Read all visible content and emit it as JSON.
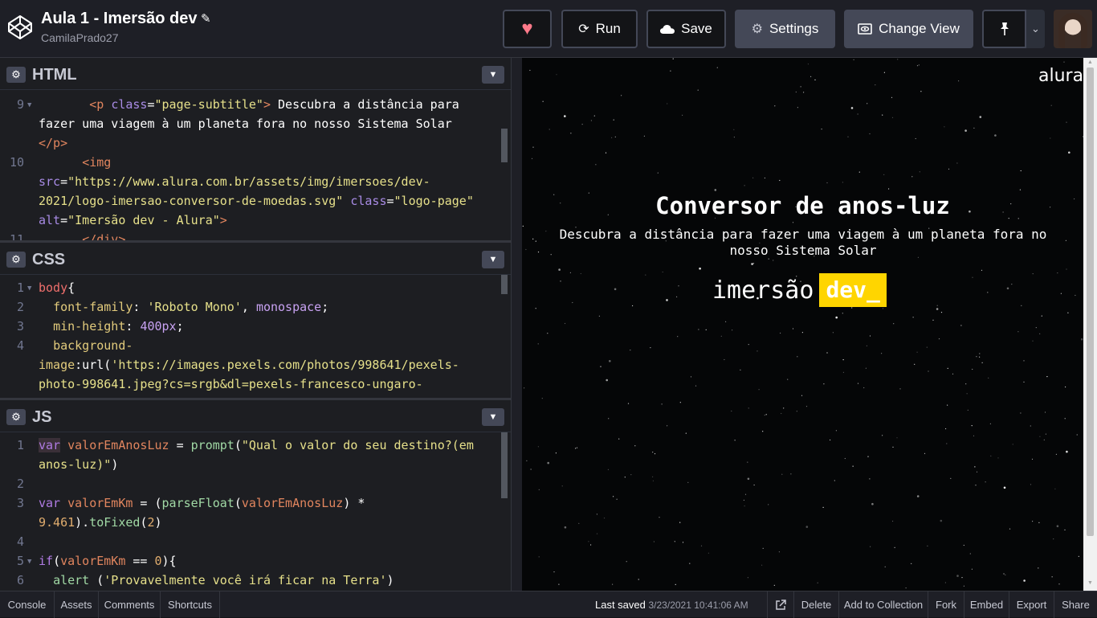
{
  "header": {
    "title": "Aula 1 - Imersão dev",
    "username": "CamilaPrado27",
    "buttons": {
      "run": "Run",
      "save": "Save",
      "settings": "Settings",
      "change_view": "Change View"
    },
    "icons": [
      "codepen-logo-icon",
      "pencil-icon",
      "heart-icon",
      "run-icon",
      "cloud-icon",
      "gear-icon",
      "change-view-icon",
      "pin-icon",
      "chevron-down-icon"
    ],
    "heart_color": "#ff7a8a"
  },
  "editors": {
    "html": {
      "label": "HTML",
      "lines": [
        {
          "n": "9"
        },
        {
          "n": ""
        },
        {
          "n": ""
        },
        {
          "n": "10"
        },
        {
          "n": ""
        },
        {
          "n": ""
        },
        {
          "n": ""
        }
      ],
      "code": {
        "l1a": "<p ",
        "l1b": "class",
        "l1c": "=",
        "l1d": "\"page-subtitle\"",
        "l1e": "> ",
        "l1f": "Descubra a distância para",
        "l2": "fazer uma viagem à um planeta fora no nosso Sistema Solar",
        "l3": "</p>",
        "l4": "<img",
        "l5a": "src",
        "l5b": "=",
        "l5c": "\"https://www.alura.com.br/assets/img/imersoes/dev-",
        "l6a": "2021/logo-imersao-conversor-de-moedas.svg\"",
        "l6b": " class",
        "l6c": "=",
        "l6d": "\"logo-page\"",
        "l7a": "alt",
        "l7b": "=",
        "l7c": "\"Imersão dev - Alura\"",
        "l7d": ">",
        "l8": "</div>"
      }
    },
    "css": {
      "label": "CSS",
      "line_numbers": [
        "1",
        "2",
        "3",
        "4"
      ],
      "code": {
        "l1a": "body",
        "l1b": "{",
        "l2a": "font-family",
        "l2b": ": ",
        "l2c": "'Roboto Mono'",
        "l2d": ", ",
        "l2e": "monospace",
        "l2f": ";",
        "l3a": "min-height",
        "l3b": ": ",
        "l3c": "400px",
        "l3d": ";",
        "l4": "background-",
        "l5a": "image",
        "l5b": ":url(",
        "l5c": "'https://images.pexels.com/photos/998641/pexels-",
        "l6": "photo-998641.jpeg?cs=srgb&dl=pexels-francesco-ungaro-"
      }
    },
    "js": {
      "label": "JS",
      "line_numbers": [
        "1",
        "2",
        "3",
        "4",
        "5",
        "6"
      ],
      "code": {
        "l1a": "var",
        "l1b": " valorEmAnosLuz",
        "l1c": " = ",
        "l1d": "prompt",
        "l1e": "(",
        "l1f": "\"Qual o valor do seu destino?(em",
        "l2": "anos-luz)\"",
        "l2b": ")",
        "l3a": "var",
        "l3b": " valorEmKm",
        "l3c": " = (",
        "l3d": "parseFloat",
        "l3e": "(",
        "l3f": "valorEmAnosLuz",
        "l3g": ") *",
        "l4a": "9.461",
        "l4b": ").",
        "l4c": "toFixed",
        "l4d": "(",
        "l4e": "2",
        "l4f": ")",
        "l5a": "if",
        "l5b": "(",
        "l5c": "valorEmKm",
        "l5d": " == ",
        "l5e": "0",
        "l5f": "){",
        "l6a": "alert",
        "l6b": " (",
        "l6c": "'Provavelmente você irá ficar na Terra'",
        "l6d": ")"
      }
    }
  },
  "preview": {
    "brand": "alura",
    "title": "Conversor de anos-luz",
    "subtitle": "Descubra a distância para fazer uma viagem à um planeta fora no nosso Sistema Solar",
    "logo_word": "imersão",
    "logo_dev": "dev_",
    "logo_accent": "#ffd500"
  },
  "footer": {
    "console": "Console",
    "assets": "Assets",
    "comments": "Comments",
    "shortcuts": "Shortcuts",
    "last_saved_label": "Last saved",
    "last_saved_time": "3/23/2021 10:41:06 AM",
    "delete": "Delete",
    "add_to_collection": "Add to Collection",
    "fork": "Fork",
    "embed": "Embed",
    "export": "Export",
    "share": "Share"
  }
}
